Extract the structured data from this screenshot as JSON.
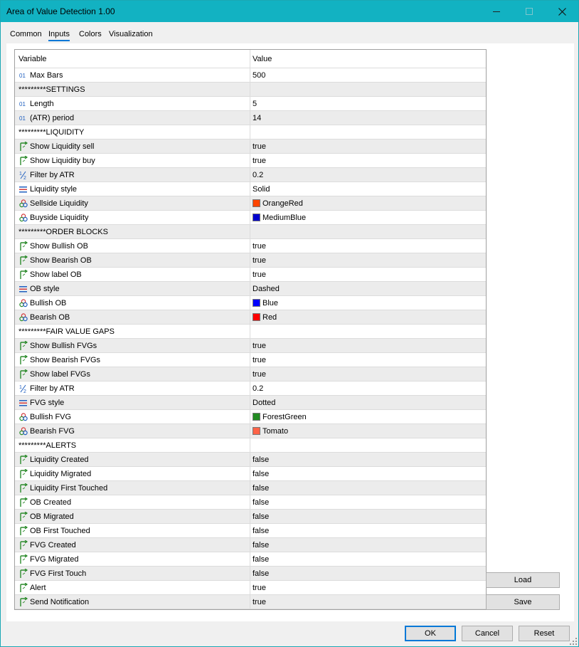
{
  "window": {
    "title": "Area of Value Detection 1.00"
  },
  "tabs": [
    {
      "label": "Common",
      "active": false
    },
    {
      "label": "Inputs",
      "active": true
    },
    {
      "label": "Colors",
      "active": false
    },
    {
      "label": "Visualization",
      "active": false
    }
  ],
  "grid": {
    "headers": {
      "variable": "Variable",
      "value": "Value"
    },
    "rows": [
      {
        "type": "int",
        "variable": "Max Bars",
        "value": "500"
      },
      {
        "type": "section",
        "variable": "*********SETTINGS",
        "value": ""
      },
      {
        "type": "int",
        "variable": "Length",
        "value": "5"
      },
      {
        "type": "int",
        "variable": "(ATR) period",
        "value": "14"
      },
      {
        "type": "section",
        "variable": "*********LIQUIDITY",
        "value": ""
      },
      {
        "type": "bool",
        "variable": "Show Liquidity sell",
        "value": "true"
      },
      {
        "type": "bool",
        "variable": "Show Liquidity buy",
        "value": "true"
      },
      {
        "type": "double",
        "variable": "Filter by ATR",
        "value": "0.2"
      },
      {
        "type": "style",
        "variable": "Liquidity style",
        "value": "Solid"
      },
      {
        "type": "color",
        "variable": "Sellside Liquidity",
        "value": "OrangeRed",
        "swatch": "#ff4500"
      },
      {
        "type": "color",
        "variable": "Buyside Liquidity",
        "value": "MediumBlue",
        "swatch": "#0000cd"
      },
      {
        "type": "section",
        "variable": "*********ORDER BLOCKS",
        "value": ""
      },
      {
        "type": "bool",
        "variable": "Show Bullish OB",
        "value": "true"
      },
      {
        "type": "bool",
        "variable": "Show Bearish OB",
        "value": "true"
      },
      {
        "type": "bool",
        "variable": "Show label OB",
        "value": "true"
      },
      {
        "type": "style",
        "variable": "OB style",
        "value": "Dashed"
      },
      {
        "type": "color",
        "variable": "Bullish OB",
        "value": "Blue",
        "swatch": "#0000ff"
      },
      {
        "type": "color",
        "variable": "Bearish OB",
        "value": "Red",
        "swatch": "#ff0000"
      },
      {
        "type": "section",
        "variable": "*********FAIR VALUE GAPS",
        "value": ""
      },
      {
        "type": "bool",
        "variable": "Show Bullish FVGs",
        "value": "true"
      },
      {
        "type": "bool",
        "variable": "Show Bearish FVGs",
        "value": "true"
      },
      {
        "type": "bool",
        "variable": "Show label FVGs",
        "value": "true"
      },
      {
        "type": "double",
        "variable": "Filter by ATR",
        "value": "0.2"
      },
      {
        "type": "style",
        "variable": "FVG style",
        "value": "Dotted"
      },
      {
        "type": "color",
        "variable": "Bullish FVG",
        "value": "ForestGreen",
        "swatch": "#228b22"
      },
      {
        "type": "color",
        "variable": "Bearish FVG",
        "value": "Tomato",
        "swatch": "#ff6347"
      },
      {
        "type": "section",
        "variable": "*********ALERTS",
        "value": ""
      },
      {
        "type": "bool",
        "variable": "Liquidity Created",
        "value": "false"
      },
      {
        "type": "bool",
        "variable": "Liquidity Migrated",
        "value": "false"
      },
      {
        "type": "bool",
        "variable": "Liquidity First Touched",
        "value": "false"
      },
      {
        "type": "bool",
        "variable": "OB Created",
        "value": "false"
      },
      {
        "type": "bool",
        "variable": "OB Migrated",
        "value": "false"
      },
      {
        "type": "bool",
        "variable": "OB First Touched",
        "value": "false"
      },
      {
        "type": "bool",
        "variable": "FVG Created",
        "value": "false"
      },
      {
        "type": "bool",
        "variable": "FVG Migrated",
        "value": "false"
      },
      {
        "type": "bool",
        "variable": "FVG First Touch",
        "value": "false"
      },
      {
        "type": "bool",
        "variable": "Alert",
        "value": "true"
      },
      {
        "type": "bool",
        "variable": "Send Notification",
        "value": "true"
      }
    ]
  },
  "side_buttons": {
    "load": "Load",
    "save": "Save"
  },
  "footer": {
    "ok": "OK",
    "cancel": "Cancel",
    "reset": "Reset"
  },
  "colors": {
    "titlebar": "#12b2c2",
    "accent": "#0078d7"
  }
}
